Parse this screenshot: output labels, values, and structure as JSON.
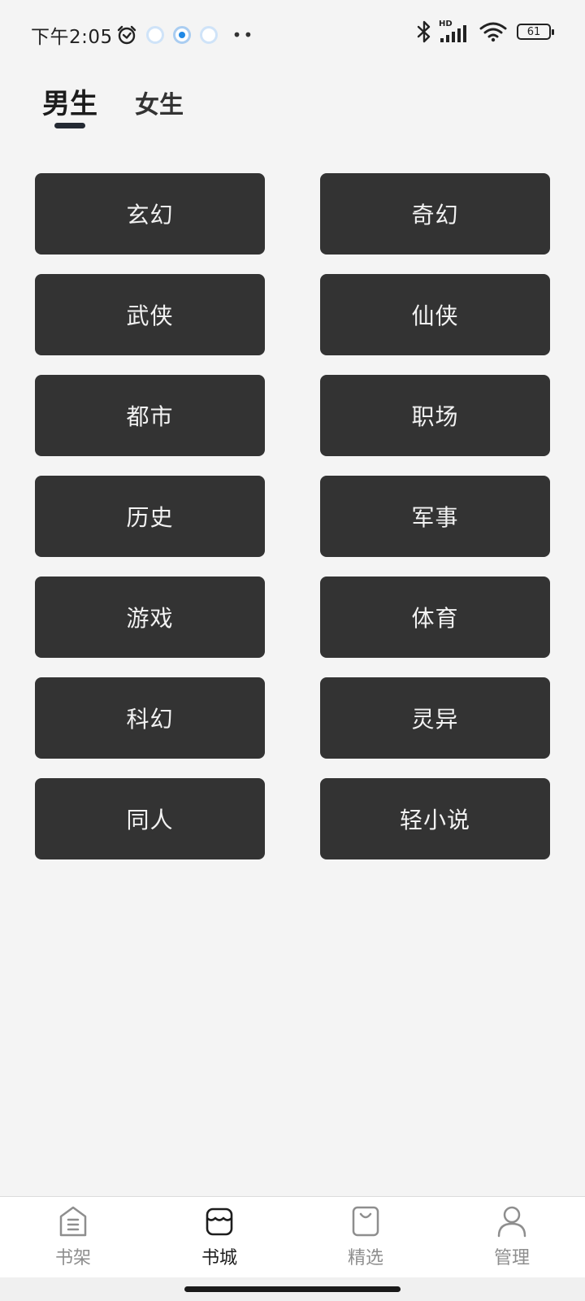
{
  "status_bar": {
    "time": "下午2:05",
    "battery": "61",
    "left_icons": [
      "alarm-icon",
      "notification-icon",
      "notification-icon",
      "notification-icon",
      "more-dots-icon"
    ],
    "right_icons": [
      "bluetooth-icon",
      "hd-signal-icon",
      "wifi-icon",
      "battery-icon"
    ],
    "signal_label": "HD"
  },
  "tabs": [
    {
      "label": "男生",
      "active": true
    },
    {
      "label": "女生",
      "active": false
    }
  ],
  "categories": [
    "玄幻",
    "奇幻",
    "武侠",
    "仙侠",
    "都市",
    "职场",
    "历史",
    "军事",
    "游戏",
    "体育",
    "科幻",
    "灵异",
    "同人",
    "轻小说"
  ],
  "bottom_nav": [
    {
      "label": "书架",
      "icon": "bookshelf-icon",
      "active": false
    },
    {
      "label": "书城",
      "icon": "bookstore-icon",
      "active": true
    },
    {
      "label": "精选",
      "icon": "shopping-bag-icon",
      "active": false
    },
    {
      "label": "管理",
      "icon": "user-icon",
      "active": false
    }
  ],
  "colors": {
    "background": "#f4f4f4",
    "category_button": "#333333",
    "category_text": "#f2f2f2",
    "nav_active": "#1d1d1d",
    "nav_inactive": "#8e8e8e",
    "tab_indicator": "#242a33"
  }
}
